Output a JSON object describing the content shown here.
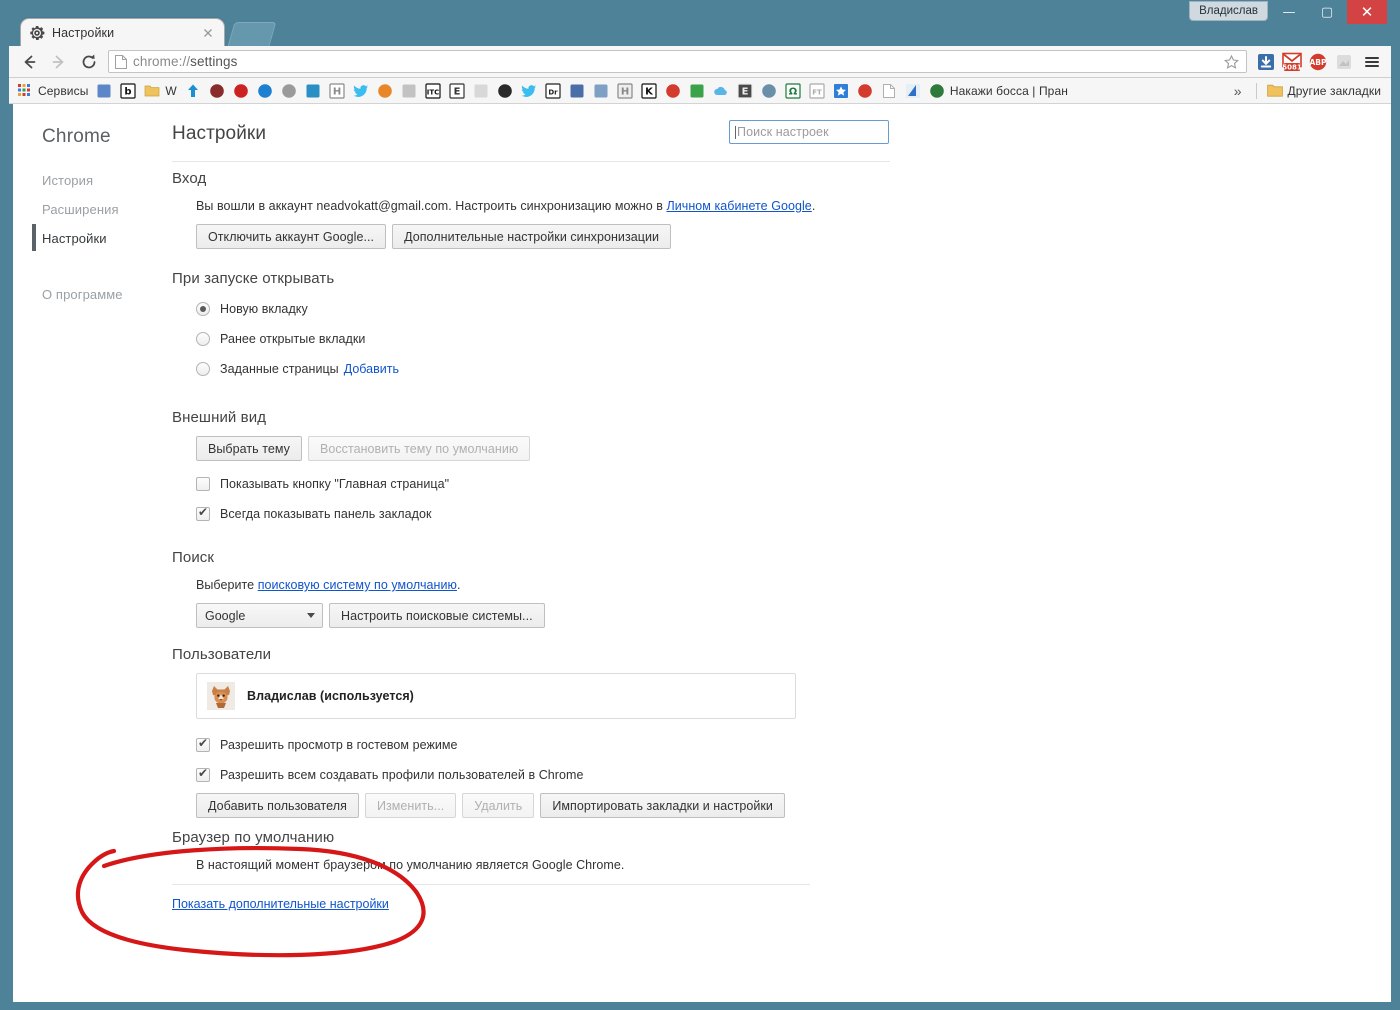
{
  "window": {
    "user_badge": "Владислав",
    "minimize": "—",
    "maximize": "▢",
    "close": "✕"
  },
  "tab": {
    "title": "Настройки",
    "favicon": "gear-icon",
    "close": "✕"
  },
  "toolbar": {
    "back": "←",
    "forward": "→",
    "reload": "⟳",
    "url_scheme": "chrome://",
    "url_path": "settings",
    "url_full": "chrome://settings",
    "star": "☆",
    "menu": "≡",
    "extensions": [
      {
        "name": "download-extension-icon",
        "badge": ""
      },
      {
        "name": "gmail-extension-icon",
        "badge": "5081"
      },
      {
        "name": "adblock-plus-extension-icon",
        "badge": "ABP"
      },
      {
        "name": "disabled-extension-icon",
        "badge": ""
      }
    ]
  },
  "bookmarks": {
    "apps_label": "Сервисы",
    "items": [
      {
        "label": "",
        "icon": "chat-bookmark-icon"
      },
      {
        "label": "",
        "icon": "b-letter-bookmark-icon"
      },
      {
        "label": "W",
        "icon": "folder-bookmark-icon"
      },
      {
        "label": "",
        "icon": "up-arrow-bookmark-icon"
      },
      {
        "label": "",
        "icon": "target-bookmark-icon"
      },
      {
        "label": "",
        "icon": "hammer-sickle-bookmark-icon"
      },
      {
        "label": "",
        "icon": "butterfly-bookmark-icon"
      },
      {
        "label": "",
        "icon": "circles-bookmark-icon"
      },
      {
        "label": "",
        "icon": "contact-bookmark-icon"
      },
      {
        "label": "",
        "icon": "h-letter-bookmark-icon"
      },
      {
        "label": "",
        "icon": "twitter-bookmark-icon"
      },
      {
        "label": "",
        "icon": "orange-flower-bookmark-icon"
      },
      {
        "label": "",
        "icon": "thermometer-bookmark-icon"
      },
      {
        "label": "",
        "icon": "itc-bookmark-icon"
      },
      {
        "label": "",
        "icon": "e-letter-bookmark-icon"
      },
      {
        "label": "",
        "icon": "pen-bookmark-icon"
      },
      {
        "label": "",
        "icon": "dark-circle-bookmark-icon"
      },
      {
        "label": "",
        "icon": "bird-bookmark-icon"
      },
      {
        "label": "",
        "icon": "dr-bookmark-icon"
      },
      {
        "label": "",
        "icon": "gif-monitor-bookmark-icon"
      },
      {
        "label": "",
        "icon": "laptop-bookmark-icon"
      },
      {
        "label": "",
        "icon": "script-h-bookmark-icon"
      },
      {
        "label": "",
        "icon": "k-letter-bookmark-icon"
      },
      {
        "label": "",
        "icon": "mario-bookmark-icon"
      },
      {
        "label": "",
        "icon": "green-grid-bookmark-icon"
      },
      {
        "label": "",
        "icon": "cloud-bookmark-icon"
      },
      {
        "label": "",
        "icon": "e-dark-bookmark-icon"
      },
      {
        "label": "",
        "icon": "person-bookmark-icon"
      },
      {
        "label": "",
        "icon": "omega-bookmark-icon"
      },
      {
        "label": "",
        "icon": "ft-bookmark-icon"
      },
      {
        "label": "",
        "icon": "blue-star-bookmark-icon"
      },
      {
        "label": "",
        "icon": "red-opera-bookmark-icon"
      },
      {
        "label": "",
        "icon": "blank-page-bookmark-icon"
      },
      {
        "label": "",
        "icon": "blue-triangle-bookmark-icon"
      },
      {
        "label": "Накажи босса | Пран",
        "icon": "green-frog-bookmark-icon"
      }
    ],
    "overflow": "»",
    "other_bookmarks": "Другие закладки"
  },
  "sidebar": {
    "brand": "Chrome",
    "items": [
      {
        "label": "История",
        "active": false
      },
      {
        "label": "Расширения",
        "active": false
      },
      {
        "label": "Настройки",
        "active": true
      },
      {
        "label": "О программе",
        "active": false
      }
    ]
  },
  "page": {
    "title": "Настройки",
    "search_placeholder": "Поиск настроек",
    "search_value": ""
  },
  "signin": {
    "title": "Вход",
    "description_prefix": "Вы вошли в аккаунт neadvokatt@gmail.com. Настроить синхронизацию можно в ",
    "link": "Личном кабинете Google",
    "description_suffix": ".",
    "disconnect_button": "Отключить аккаунт Google...",
    "advanced_button": "Дополнительные настройки синхронизации"
  },
  "startup": {
    "title": "При запуске открывать",
    "options": [
      {
        "label": "Новую вкладку",
        "checked": true
      },
      {
        "label": "Ранее открытые вкладки",
        "checked": false
      },
      {
        "label": "Заданные страницы",
        "checked": false,
        "link": "Добавить"
      }
    ]
  },
  "appearance": {
    "title": "Внешний вид",
    "choose_theme_button": "Выбрать тему",
    "reset_theme_button": "Восстановить тему по умолчанию",
    "reset_theme_disabled": true,
    "checkboxes": [
      {
        "label": "Показывать кнопку \"Главная страница\"",
        "checked": false
      },
      {
        "label": "Всегда показывать панель закладок",
        "checked": true
      }
    ]
  },
  "search": {
    "title": "Поиск",
    "description_prefix": "Выберите ",
    "link": "поисковую систему по умолчанию",
    "description_suffix": ".",
    "engine_selected": "Google",
    "manage_button": "Настроить поисковые системы..."
  },
  "users": {
    "title": "Пользователи",
    "current_user": "Владислав (используется)",
    "avatar": "fox-avatar",
    "checkboxes": [
      {
        "label": "Разрешить просмотр в гостевом режиме",
        "checked": true
      },
      {
        "label": "Разрешить всем создавать профили пользователей в Chrome",
        "checked": true
      }
    ],
    "buttons": [
      {
        "label": "Добавить пользователя",
        "disabled": false
      },
      {
        "label": "Изменить...",
        "disabled": true
      },
      {
        "label": "Удалить",
        "disabled": true
      },
      {
        "label": "Импортировать закладки и настройки",
        "disabled": false
      }
    ]
  },
  "default_browser": {
    "title": "Браузер по умолчанию",
    "status": "В настоящий момент браузером по умолчанию является Google Chrome."
  },
  "advanced": {
    "link": "Показать дополнительные настройки"
  },
  "annotation": {
    "type": "hand-drawn-ellipse",
    "color": "#d51717",
    "target": "Показать дополнительные настройки"
  },
  "colors": {
    "frame": "#4d8299",
    "toolbar": "#f6f6f6",
    "link": "#1155cc",
    "close_button": "#d44343",
    "annotation_red": "#d51717"
  }
}
